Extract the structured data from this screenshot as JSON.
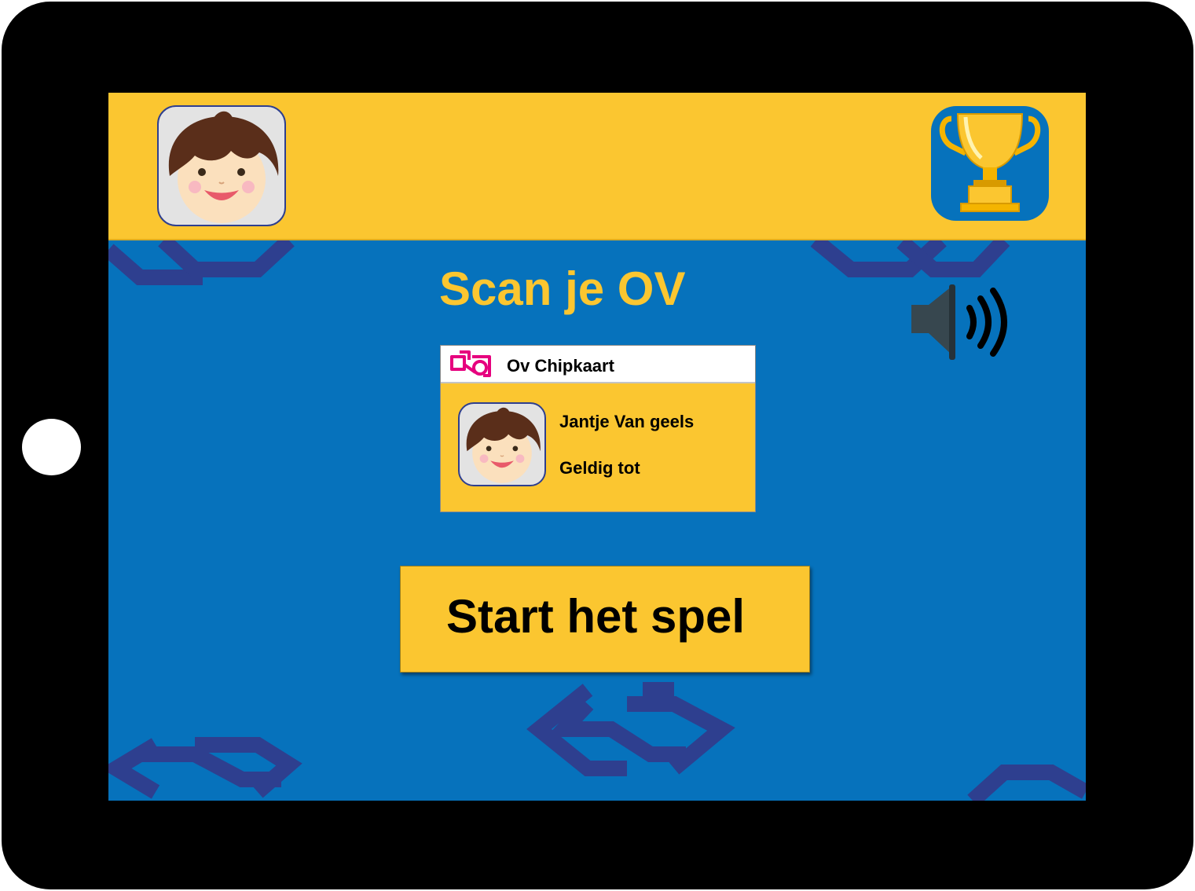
{
  "header": {
    "profile_icon": "child-face-icon",
    "trophy_icon": "trophy-icon"
  },
  "main": {
    "title": "Scan je OV",
    "sound_icon": "speaker-volume-icon"
  },
  "ov_card": {
    "title": "Ov Chipkaart",
    "logo_icon": "ov-logo-icon",
    "holder_name": "Jantje Van geels",
    "valid_label": "Geldig tot"
  },
  "start_button": {
    "label": "Start het spel"
  },
  "colors": {
    "yellow": "#fbc630",
    "blue": "#0672bc",
    "pattern": "#2e3f8f",
    "ov_pink": "#e6007e"
  }
}
